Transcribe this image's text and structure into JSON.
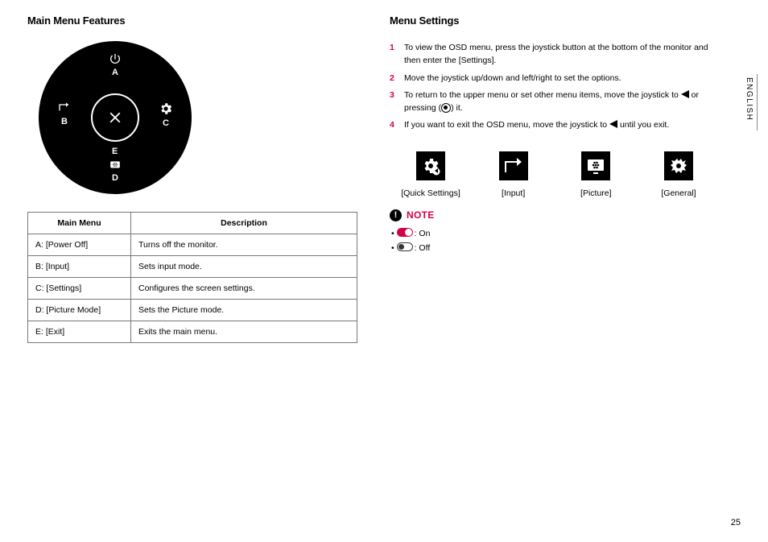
{
  "language_label": "ENGLISH",
  "page_number": "25",
  "left": {
    "heading": "Main Menu Features",
    "positions": {
      "A": "A",
      "B": "B",
      "C": "C",
      "D": "D",
      "E": "E"
    },
    "table": {
      "head_menu": "Main Menu",
      "head_desc": "Description",
      "rows": [
        {
          "menu": "A: [Power Off]",
          "desc": "Turns off the monitor."
        },
        {
          "menu": "B: [Input]",
          "desc": "Sets input mode."
        },
        {
          "menu": "C: [Settings]",
          "desc": "Configures the screen settings."
        },
        {
          "menu": "D: [Picture Mode]",
          "desc": "Sets the Picture mode."
        },
        {
          "menu": "E: [Exit]",
          "desc": "Exits the main menu."
        }
      ]
    }
  },
  "right": {
    "heading": "Menu Settings",
    "steps": [
      {
        "n": "1",
        "t": "To view the OSD menu, press the joystick button at the bottom of the monitor and then enter the [Settings]."
      },
      {
        "n": "2",
        "t": "Move the joystick up/down and left/right to set the options."
      },
      {
        "n": "3",
        "t_pre": "To return to the upper menu or set other menu items, move the joystick to ",
        "t_mid": " or pressing (",
        "t_post": ") it."
      },
      {
        "n": "4",
        "t_pre": "If you want to exit the OSD menu, move the joystick to ",
        "t_post": " until you exit."
      }
    ],
    "icons": [
      {
        "label": "[Quick Settings]"
      },
      {
        "label": "[Input]"
      },
      {
        "label": "[Picture]"
      },
      {
        "label": "[General]"
      }
    ],
    "note_label": "NOTE",
    "note_items": {
      "on": ": On",
      "off": ": Off"
    }
  }
}
